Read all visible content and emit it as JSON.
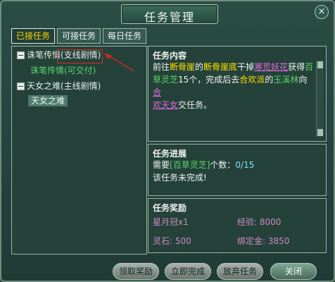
{
  "window": {
    "title": "任务管理",
    "close_icon": "close-icon"
  },
  "tabs": [
    {
      "label": "已接任务",
      "active": true
    },
    {
      "label": "可接任务",
      "active": false
    },
    {
      "label": "每日任务",
      "active": false
    }
  ],
  "tree": {
    "nodes": [
      {
        "label": "诛笔传情(支线剧情)",
        "children": [
          {
            "label": "诛笔传情(可交付)",
            "selected": false
          }
        ]
      },
      {
        "label": "天女之难(主线剧情)",
        "children": [
          {
            "label": "天女之难",
            "selected": true
          }
        ]
      }
    ]
  },
  "content": {
    "heading": "任务内容",
    "line1_a": "前往",
    "line1_b": "断骨崖",
    "line1_c": "的",
    "line1_d": "断骨崖底",
    "line1_e": "干掉",
    "line1_f": "寒荒妖花",
    "line1_g": "获得",
    "line1_h": "百",
    "line2_a": "草灵芝",
    "line2_b": "15个，完成后去",
    "line2_c": "合欢派",
    "line2_d": "的",
    "line2_e": "玉溪林",
    "line2_f": "向",
    "line2_g": "合",
    "line3_a": "欢天女",
    "line3_b": "交任务。"
  },
  "progress": {
    "heading": "任务进展",
    "line1_a": "需要",
    "line1_b": "[百草灵芝]",
    "line1_c": "个数：",
    "line1_d": "0/15",
    "line2": "该任务未完成!"
  },
  "rewards": {
    "heading": "任务奖励",
    "items": [
      {
        "label": "星月冠x1"
      },
      {
        "label": "经验: 8000"
      },
      {
        "label": "灵石: 500"
      },
      {
        "label": "绑定金: 3850"
      }
    ]
  },
  "buttons": {
    "claim": "领取奖励",
    "complete": "立即完成",
    "abandon": "放弃任务",
    "close": "关闭"
  },
  "colors": {
    "accent": "#ffd400",
    "green": "#5ad36d",
    "magenta": "#e56ae0"
  }
}
